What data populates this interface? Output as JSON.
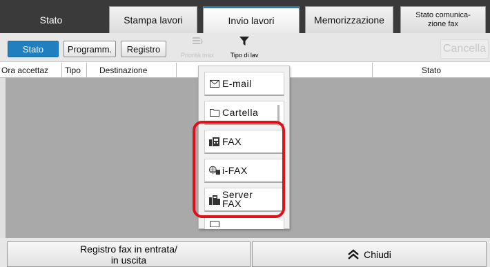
{
  "tabs": [
    {
      "label": "Stato"
    },
    {
      "label": "Stampa lavori"
    },
    {
      "label": "Invio lavori"
    },
    {
      "label": "Memorizzazione"
    },
    {
      "label": "Stato comunica-\nzione fax"
    }
  ],
  "toolbar": {
    "stato": "Stato",
    "programm": "Programm.",
    "registro": "Registro",
    "priority": "Priorità max",
    "filter": "Tipo di lav",
    "cancel": "Cancella"
  },
  "table": {
    "headers": [
      "Ora accettaz",
      "Tipo",
      "Destinazione",
      "",
      "Stato"
    ]
  },
  "dropdown": {
    "items": [
      {
        "label": "E-mail",
        "icon": "envelope-icon"
      },
      {
        "label": "Cartella",
        "icon": "folder-icon"
      },
      {
        "label": "FAX",
        "icon": "fax-icon"
      },
      {
        "label": "i-FAX",
        "icon": "globe-fax-icon"
      },
      {
        "label": "Server\nFAX",
        "icon": "server-fax-icon"
      },
      {
        "label": "",
        "icon": "checkbox-icon"
      }
    ]
  },
  "bottom": {
    "fax_log": "Registro fax in entrata/\nin uscita",
    "close": "Chiudi"
  },
  "colors": {
    "accent": "#1f7fc0",
    "highlight": "#e0101a",
    "dark": "#3a3a3a"
  }
}
